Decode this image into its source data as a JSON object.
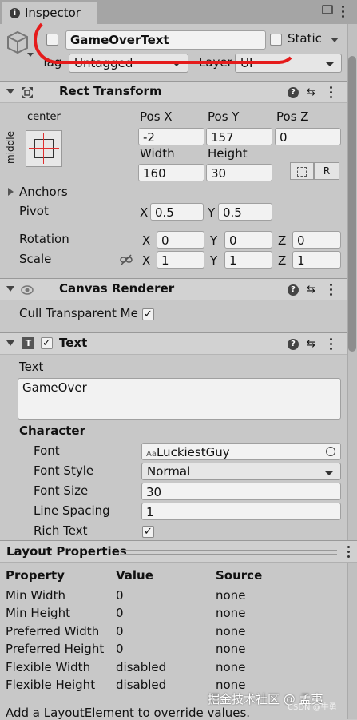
{
  "tab": {
    "title": "Inspector"
  },
  "object": {
    "name": "GameOverText",
    "static_label": "Static",
    "tag_label": "Tag",
    "tag_value": "Untagged",
    "layer_label": "Layer",
    "layer_value": "UI"
  },
  "rect": {
    "title": "Rect Transform",
    "anchor_h": "center",
    "anchor_v": "middle",
    "posx_label": "Pos X",
    "posy_label": "Pos Y",
    "posz_label": "Pos Z",
    "posx": "-2",
    "posy": "157",
    "posz": "0",
    "width_label": "Width",
    "height_label": "Height",
    "width": "160",
    "height": "30",
    "r_button": "R",
    "anchors_label": "Anchors",
    "pivot_label": "Pivot",
    "pivot_x": "0.5",
    "pivot_y": "0.5",
    "rotation_label": "Rotation",
    "rot_x": "0",
    "rot_y": "0",
    "rot_z": "0",
    "scale_label": "Scale",
    "scale_x": "1",
    "scale_y": "1",
    "scale_z": "1",
    "x": "X",
    "y": "Y",
    "z": "Z"
  },
  "canvas": {
    "title": "Canvas Renderer",
    "cull_label": "Cull Transparent Me"
  },
  "text": {
    "title": "Text",
    "text_label": "Text",
    "text_value": "GameOver",
    "character_label": "Character",
    "font_label": "Font",
    "font_value": "LuckiestGuy",
    "font_prefix": "Aa",
    "font_style_label": "Font Style",
    "font_style_value": "Normal",
    "font_size_label": "Font Size",
    "font_size_value": "30",
    "line_spacing_label": "Line Spacing",
    "line_spacing_value": "1",
    "rich_text_label": "Rich Text"
  },
  "layout": {
    "title": "Layout Properties",
    "headers": [
      "Property",
      "Value",
      "Source"
    ],
    "rows": [
      [
        "Min Width",
        "0",
        "none"
      ],
      [
        "Min Height",
        "0",
        "none"
      ],
      [
        "Preferred Width",
        "0",
        "none"
      ],
      [
        "Preferred Height",
        "0",
        "none"
      ],
      [
        "Flexible Width",
        "disabled",
        "none"
      ],
      [
        "Flexible Height",
        "disabled",
        "none"
      ]
    ],
    "footer": "Add a LayoutElement to override values."
  },
  "watermark": "掘金技术社区 @ 孟夷",
  "watermark2": "CSDN @牛勇",
  "colors": {
    "annotation": "#e51b1b",
    "background": "#c8c8c8"
  }
}
